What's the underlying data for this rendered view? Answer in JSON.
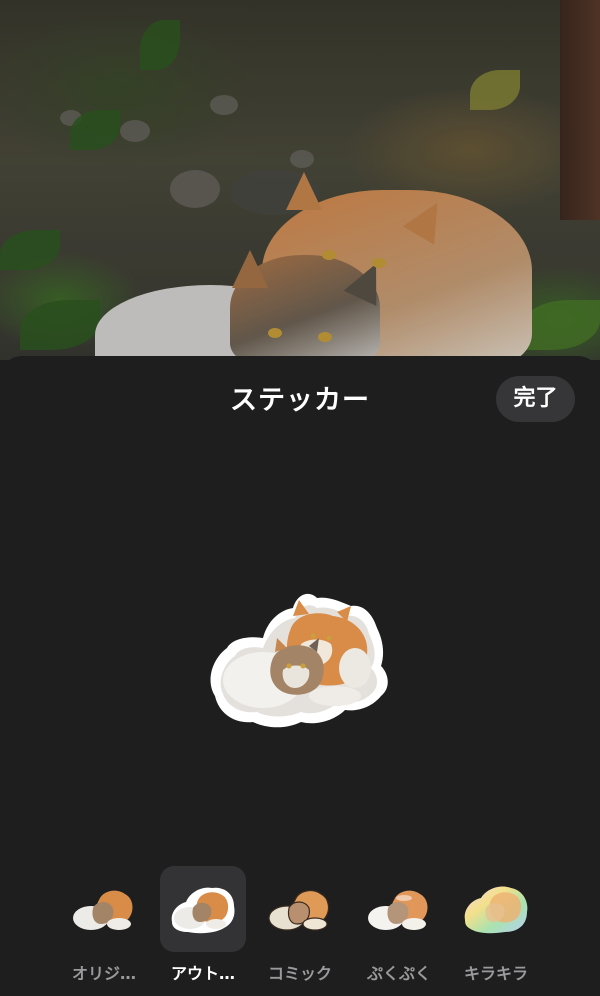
{
  "sheet": {
    "title": "ステッカー",
    "done_label": "完了"
  },
  "styles": [
    {
      "label": "オリジ…",
      "selected": false,
      "icon": "original-sticker-thumb"
    },
    {
      "label": "アウト…",
      "selected": true,
      "icon": "outline-sticker-thumb"
    },
    {
      "label": "コミック",
      "selected": false,
      "icon": "comic-sticker-thumb"
    },
    {
      "label": "ぷくぷく",
      "selected": false,
      "icon": "puffy-sticker-thumb"
    },
    {
      "label": "キラキラ",
      "selected": false,
      "icon": "shiny-sticker-thumb"
    }
  ],
  "colors": {
    "sheet_bg": "#1e1e1f",
    "button_bg": "#363638",
    "selected_bg": "#333335",
    "label_inactive": "#9a9a9c",
    "label_active": "#ffffff"
  }
}
